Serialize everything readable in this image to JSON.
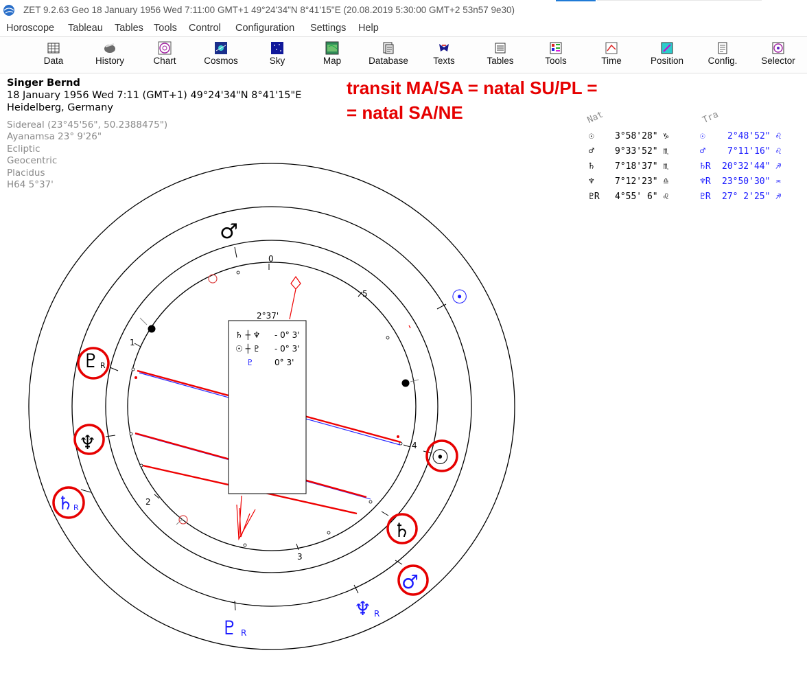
{
  "window": {
    "title": "ZET 9.2.63 Geo    18 January 1956  Wed    7:11:00 GMT+1 49°24'34\"N  8°41'15\"E  (20.08.2019   5:30:00 GMT+2 53n57 9e30)"
  },
  "menu": [
    "Horoscope",
    "Tableau",
    "Tables",
    "Tools",
    "Control",
    "Configuration",
    "Settings",
    "Help"
  ],
  "toolbar": [
    {
      "label": "Data",
      "icon": "data-grid-icon"
    },
    {
      "label": "History",
      "icon": "history-icon"
    },
    {
      "label": "Chart",
      "icon": "chart-wheel-icon"
    },
    {
      "label": "Cosmos",
      "icon": "cosmos-icon"
    },
    {
      "label": "Sky",
      "icon": "sky-icon"
    },
    {
      "label": "Map",
      "icon": "map-icon"
    },
    {
      "label": "Database",
      "icon": "database-icon"
    },
    {
      "label": "Texts",
      "icon": "texts-icon"
    },
    {
      "label": "Tables",
      "icon": "tables-icon"
    },
    {
      "label": "Tools",
      "icon": "tools-icon"
    },
    {
      "label": "Time",
      "icon": "time-icon"
    },
    {
      "label": "Position",
      "icon": "position-icon"
    },
    {
      "label": "Config.",
      "icon": "config-icon"
    },
    {
      "label": "Selector",
      "icon": "selector-icon"
    }
  ],
  "horoscope": {
    "name": "Singer Bernd",
    "datetime_line": "18 January 1956  Wed   7:11 (GMT+1) 49°24'34\"N  8°41'15\"E",
    "place": "Heidelberg, Germany",
    "settings": [
      "Sidereal (23°45'56\", 50.2388475\")",
      "Ayanamsa 23° 9'26\"",
      "Ecliptic",
      "Geocentric",
      "Placidus",
      "H64   5°37'"
    ]
  },
  "annotation": {
    "line1": "transit MA/SA = natal SU/PL =",
    "line2": "= natal SA/NE",
    "color": "#e60000"
  },
  "table": {
    "col_nat": "Nat",
    "col_tra": "Tra",
    "rows": [
      {
        "nat_glyph": "☉",
        "nat_pos": "3°58'28\" ♑",
        "tra_glyph": "☉",
        "tra_pos": "2°48'52\" ♌"
      },
      {
        "nat_glyph": "♂",
        "nat_pos": "9°33'52\" ♏",
        "tra_glyph": "♂",
        "tra_pos": "7°11'16\" ♌"
      },
      {
        "nat_glyph": "♄",
        "nat_pos": "7°18'37\" ♏",
        "tra_glyph": "♄R",
        "tra_pos": "20°32'44\" ♐"
      },
      {
        "nat_glyph": "♆",
        "nat_pos": "7°12'23\" ♎",
        "tra_glyph": "♆R",
        "tra_pos": "23°50'30\" ♒"
      },
      {
        "nat_glyph": "♇R",
        "nat_pos": "4°55' 6\" ♌",
        "tra_glyph": "♇R",
        "tra_pos": "27° 2'25\" ♐"
      }
    ],
    "nat_color": "#000000",
    "tra_color": "#1a1aff"
  },
  "dial": {
    "arc_label": "2°37'",
    "midpoints": [
      {
        "glyphs": "♄ ┼ ♆",
        "orb": "- 0° 3'"
      },
      {
        "glyphs": "☉ ┼ ♇",
        "orb": "- 0° 3'"
      },
      {
        "glyphs": "♇",
        "orb": "0° 3'"
      }
    ],
    "tick_labels": [
      "0",
      "1",
      "2",
      "3",
      "4",
      "5"
    ],
    "natal_glyphs": [
      "♂",
      "♇",
      "♆",
      "☉",
      "♄"
    ],
    "transit_glyphs": [
      "☉",
      "♄",
      "♂",
      "♆",
      "♇"
    ],
    "retro_mark": "R"
  }
}
